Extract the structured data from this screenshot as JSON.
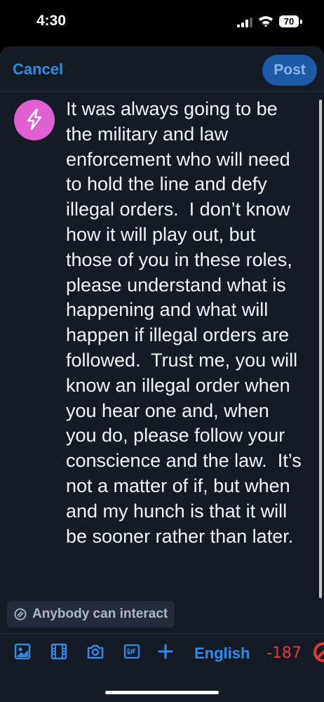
{
  "status": {
    "time": "4:30",
    "battery": "70"
  },
  "header": {
    "cancel_label": "Cancel",
    "post_label": "Post"
  },
  "post": {
    "text": "It was always going to be the military and law enforcement who will need to hold the line and defy illegal orders.  I don’t know how it will play out, but those of you in these roles, please understand what is happening and what will happen if illegal orders are followed.  Trust me, you will know an illegal order when you hear one and, when you do, please follow your conscience and the law.  It’s not a matter of if, but when and my hunch is that it will be sooner rather than later."
  },
  "interaction": {
    "label": "Anybody can interact",
    "icon": "interaction-settings-icon"
  },
  "toolbar": {
    "icons": [
      "image-icon",
      "video-icon",
      "camera-icon",
      "gif-icon",
      "plus-icon"
    ],
    "language": "English",
    "char_count": "-187",
    "colors": {
      "accent": "#2d8bea",
      "over_limit": "#e03a3a"
    }
  }
}
